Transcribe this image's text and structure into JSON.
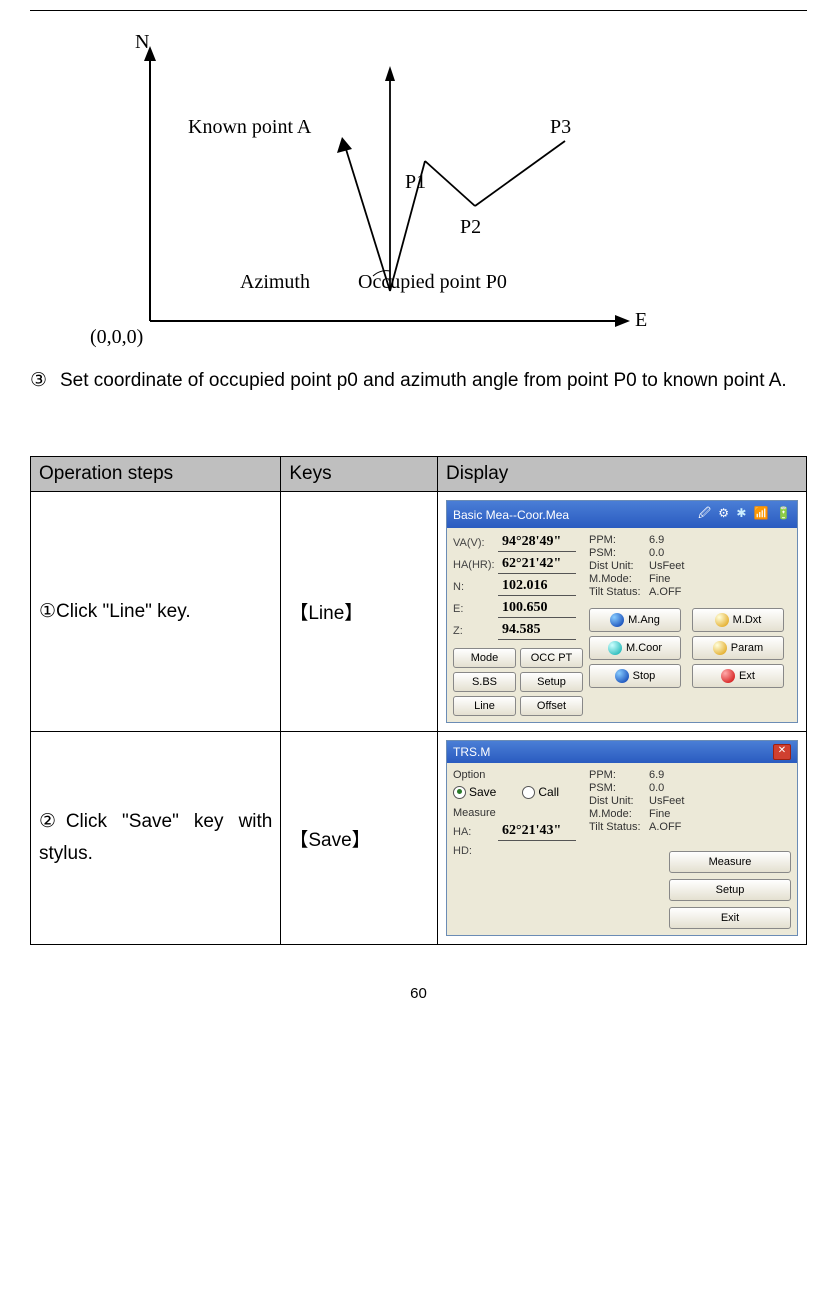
{
  "diagram": {
    "n": "N",
    "e": "E",
    "origin": "(0,0,0)",
    "azimuth": "Azimuth",
    "knownA": "Known point A",
    "occupied": "Occupied point P0",
    "p1": "P1",
    "p2": "P2",
    "p3": "P3"
  },
  "instruction": {
    "num": "③",
    "text": "Set coordinate of occupied point p0 and azimuth angle from point P0 to known point A."
  },
  "table": {
    "headers": {
      "c1": "Operation steps",
      "c2": "Keys",
      "c3": "Display"
    },
    "row1": {
      "op": "①Click \"Line\" key.",
      "key": "【Line】",
      "screen": {
        "title": "Basic Mea--Coor.Mea",
        "fields": [
          {
            "label": "VA(V):",
            "value": "94°28'49\""
          },
          {
            "label": "HA(HR):",
            "value": "62°21'42\""
          },
          {
            "label": "N:",
            "value": "102.016"
          },
          {
            "label": "E:",
            "value": "100.650"
          },
          {
            "label": "Z:",
            "value": "94.585"
          }
        ],
        "info": {
          "ppm_l": "PPM:",
          "ppm_v": "6.9",
          "psm_l": "PSM:",
          "psm_v": "0.0",
          "du_l": "Dist Unit:",
          "du_v": "UsFeet",
          "mm_l": "M.Mode:",
          "mm_v": "Fine",
          "ts_l": "Tilt Status:",
          "ts_v": "A.OFF"
        },
        "buttons_left": [
          "Mode",
          "OCC PT",
          "S.BS",
          "Setup",
          "Line",
          "Offset"
        ],
        "right_btns": [
          {
            "label": "M.Ang"
          },
          {
            "label": "M.Dxt"
          },
          {
            "label": "M.Coor"
          },
          {
            "label": "Param"
          },
          {
            "label": "Stop"
          },
          {
            "label": "Ext"
          }
        ]
      }
    },
    "row2": {
      "op": "②Click \"Save\" key with stylus.",
      "key": "【Save】",
      "screen": {
        "title": "TRS.M",
        "option_label": "Option",
        "save": "Save",
        "call": "Call",
        "measure_label": "Measure",
        "ha_label": "HA:",
        "ha_value": "62°21'43\"",
        "hd_label": "HD:",
        "info": {
          "ppm_l": "PPM:",
          "ppm_v": "6.9",
          "psm_l": "PSM:",
          "psm_v": "0.0",
          "du_l": "Dist Unit:",
          "du_v": "UsFeet",
          "mm_l": "M.Mode:",
          "mm_v": "Fine",
          "ts_l": "Tilt Status:",
          "ts_v": "A.OFF"
        },
        "right_btns": [
          "Measure",
          "Setup",
          "Exit"
        ]
      }
    }
  },
  "page_number": "60"
}
